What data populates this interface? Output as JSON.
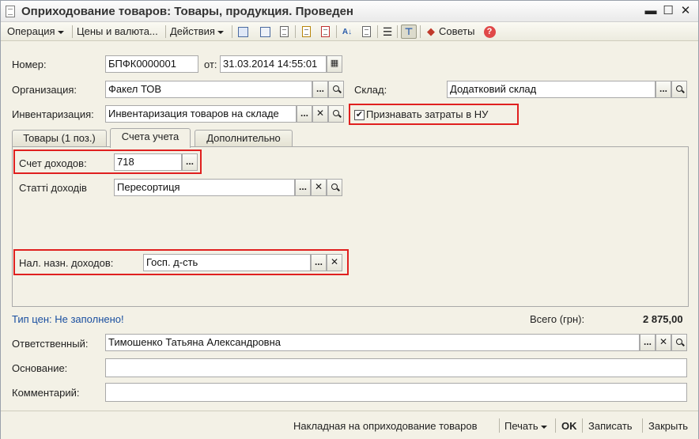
{
  "window": {
    "title": "Оприходование товаров: Товары, продукция. Проведен",
    "minimize": "▬",
    "maximize": "☐",
    "close": "✕"
  },
  "toolbar": {
    "operation": "Операция",
    "prices": "Цены и валюта...",
    "actions": "Действия",
    "advice": "Советы",
    "help": "?"
  },
  "form": {
    "number_label": "Номер:",
    "number_value": "БПФК0000001",
    "date_label": "от:",
    "date_value": "31.03.2014 14:55:01",
    "org_label": "Организация:",
    "org_value": "Факел ТОВ",
    "warehouse_label": "Склад:",
    "warehouse_value": "Додатковий склад",
    "inventory_label": "Инвентаризация:",
    "inventory_value": "Инвентаризация товаров на складе",
    "recognize_label": "Признавать затраты в НУ",
    "recognize_checked": "✔"
  },
  "tabs": [
    {
      "label": "Товары (1 поз.)"
    },
    {
      "label": "Счета учета"
    },
    {
      "label": "Дополнительно"
    }
  ],
  "accounts": {
    "income_account_label": "Счет доходов:",
    "income_account_value": "718",
    "income_items_label": "Статті доходів",
    "income_items_value": "Пересортиця",
    "tax_purpose_label": "Нал. назн. доходов:",
    "tax_purpose_value": "Госп. д-сть"
  },
  "summary": {
    "price_type": "Тип цен: Не заполнено!",
    "total_label": "Всего (грн):",
    "total_value": "2 875,00"
  },
  "footer_fields": {
    "responsible_label": "Ответственный:",
    "responsible_value": "Тимошенко Татьяна Александровна",
    "basis_label": "Основание:",
    "basis_value": "",
    "comment_label": "Комментарий:",
    "comment_value": ""
  },
  "bottombar": {
    "invoice": "Накладная на оприходование товаров",
    "print": "Печать",
    "ok": "OK",
    "save": "Записать",
    "close": "Закрыть"
  },
  "buttons": {
    "select": "...",
    "clear": "✕"
  }
}
